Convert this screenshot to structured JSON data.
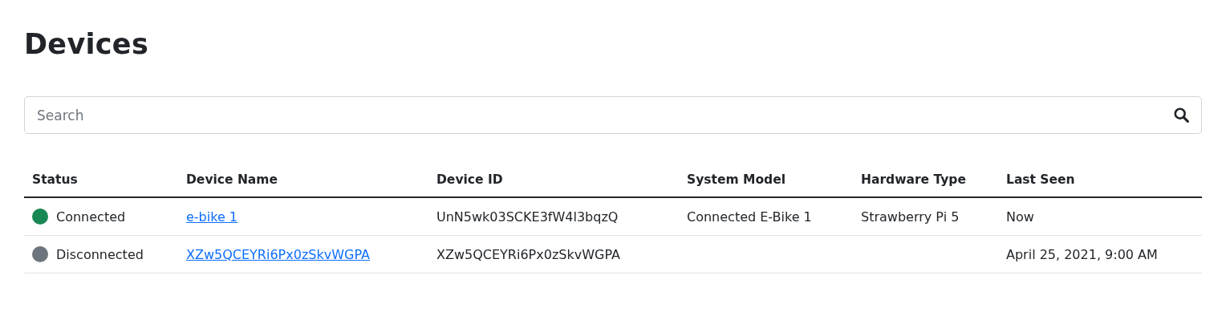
{
  "title": "Devices",
  "search": {
    "placeholder": "Search"
  },
  "table": {
    "columns": [
      "Status",
      "Device Name",
      "Device ID",
      "System Model",
      "Hardware Type",
      "Last Seen"
    ],
    "rows": [
      {
        "status": "Connected",
        "color": "#198754",
        "device_name": "e-bike 1",
        "device_id": "UnN5wk03SCKE3fW4l3bqzQ",
        "system_model": "Connected E-Bike 1",
        "hardware_type": "Strawberry Pi 5",
        "last_seen": "Now"
      },
      {
        "status": "Disconnected",
        "color": "#6c757d",
        "device_name": "XZw5QCEYRi6Px0zSkvWGPA",
        "device_id": "XZw5QCEYRi6Px0zSkvWGPA",
        "last_seen": "April 25, 2021, 9:00 AM"
      }
    ]
  }
}
